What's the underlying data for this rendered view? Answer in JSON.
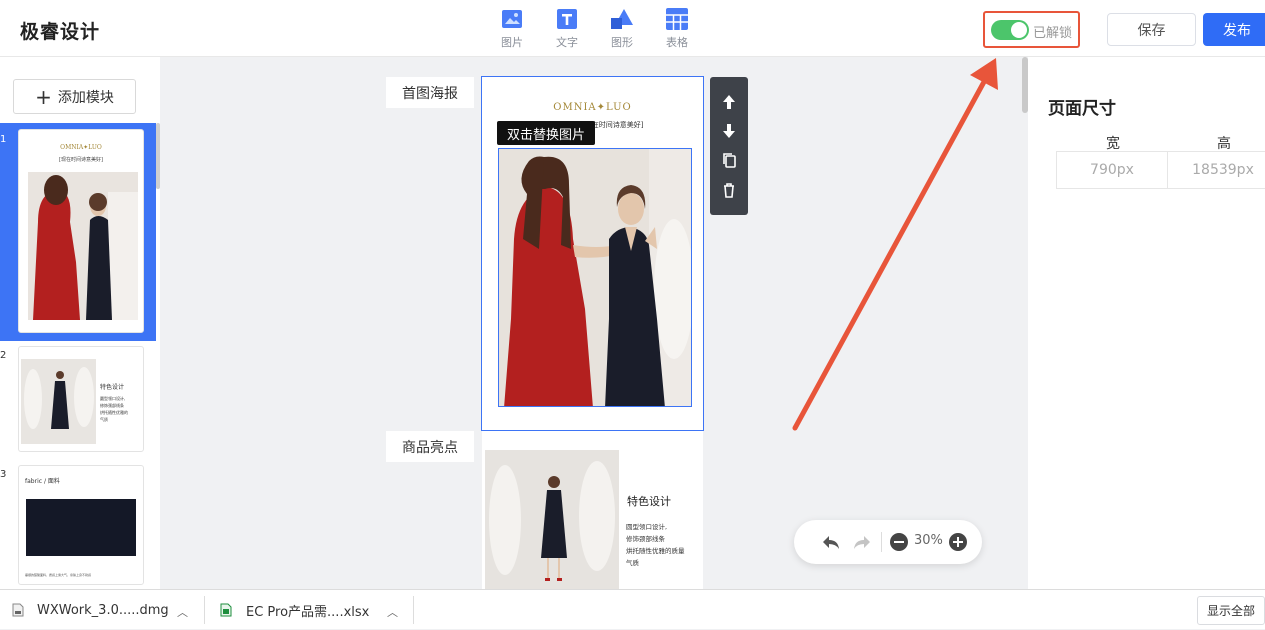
{
  "app": {
    "title": "极睿设计"
  },
  "toolbar": {
    "tools": [
      {
        "label": "图片",
        "icon": "image-icon"
      },
      {
        "label": "文字",
        "icon": "text-icon"
      },
      {
        "label": "图形",
        "icon": "shape-icon"
      },
      {
        "label": "表格",
        "icon": "table-icon"
      }
    ],
    "lock_label": "已解锁",
    "lock_on": true,
    "save_label": "保存",
    "publish_label": "发布"
  },
  "sidebar": {
    "add_module_label": "添加模块",
    "thumbs": [
      {
        "num": "1",
        "brand": "OMNIA✦LUO",
        "subtitle": "[现在时间诗意美好]"
      },
      {
        "num": "2",
        "title": "特色设计",
        "lines": [
          "圆型领口设计,",
          "修饰颈部线条",
          "烘托随性优雅的",
          "气质"
        ]
      },
      {
        "num": "3",
        "title": "fabric  / 面料",
        "caption": "垂顺的醋酸面料，质感上乘大气，亲肤上身不勒感"
      }
    ]
  },
  "canvas": {
    "section_poster": "首图海报",
    "section_highlights": "商品亮点",
    "brand": "OMNIA✦LUO",
    "subtitle": "[现在时间诗意美好]",
    "replace_tooltip": "双击替换图片",
    "feature_title": "特色设计",
    "feature_lines": [
      "圆型领口设计,",
      "修饰颈部线条",
      "烘托随性优雅的质量",
      "气质"
    ],
    "zoom": "30%"
  },
  "page_size": {
    "title": "页面尺寸",
    "width_label": "宽",
    "height_label": "高",
    "width_value": "790px",
    "height_value": "18539px"
  },
  "downloads": {
    "items": [
      {
        "name": "WXWork_3.0.....dmg"
      },
      {
        "name": "EC Pro产品需....xlsx"
      }
    ],
    "show_all": "显示全部"
  },
  "colors": {
    "accent": "#2f6cf6",
    "toggle_on": "#4cc56b",
    "highlight": "#e8553a"
  }
}
